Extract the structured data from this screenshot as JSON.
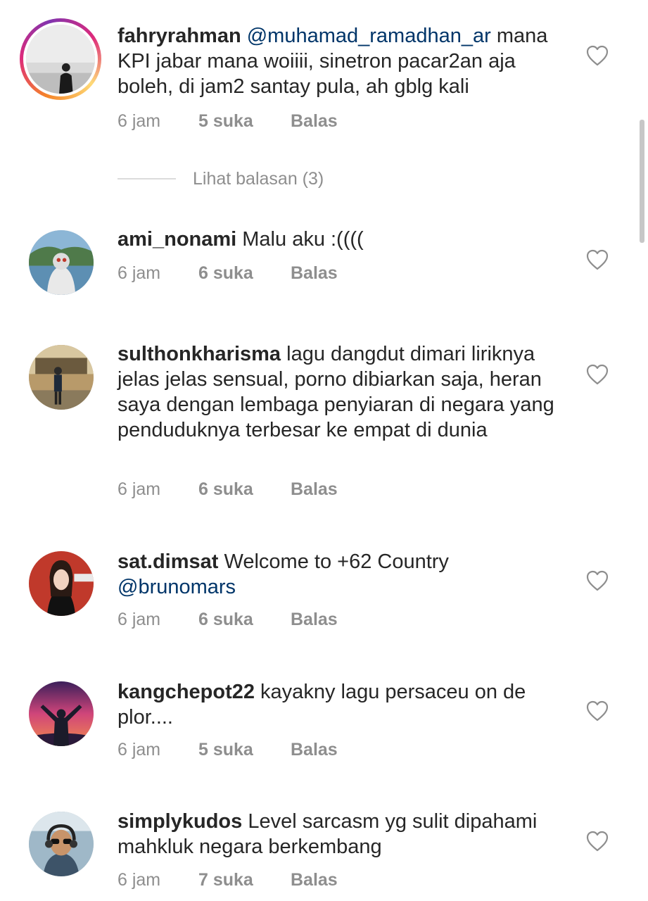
{
  "comments": [
    {
      "username": "fahryrahman",
      "mention": "@muhamad_ramadhan_ar",
      "text": " mana KPI jabar mana woiiii, sinetron pacar2an aja boleh, di jam2 santay pula, ah gblg kali",
      "time": "6 jam",
      "likes": "5 suka",
      "reply": "Balas",
      "avatar": "person-silhouette-grey-sky"
    },
    {
      "username": "ami_nonami",
      "text": " Malu aku :((((",
      "time": "6 jam",
      "likes": "6 suka",
      "reply": "Balas",
      "avatar": "person-beach-headscarf"
    },
    {
      "username": "sulthonkharisma",
      "text": " lagu dangdut dimari liriknya jelas jelas sensual, porno dibiarkan saja, heran saya dengan lembaga penyiaran di negara yang penduduknya terbesar ke empat di dunia",
      "time": "6 jam",
      "likes": "6 suka",
      "reply": "Balas",
      "avatar": "person-standing-building"
    },
    {
      "username": "sat.dimsat",
      "text": " Welcome to +62 Country ",
      "mention": "@brunomars",
      "time": "6 jam",
      "likes": "6 suka",
      "reply": "Balas",
      "avatar": "woman-red-background"
    },
    {
      "username": "kangchepot22",
      "text": " kayakny lagu persaceu on de plor....",
      "time": "6 jam",
      "likes": "5 suka",
      "reply": "Balas",
      "avatar": "person-sunset-silhouette"
    },
    {
      "username": "simplykudos",
      "text": " Level sarcasm yg sulit dipahami mahkluk negara berkembang",
      "time": "6 jam",
      "likes": "7 suka",
      "reply": "Balas",
      "avatar": "pilot-headset-sunglasses"
    }
  ],
  "view_replies": "Lihat balasan (3)",
  "icons": {
    "like": "heart-outline-icon"
  },
  "colors": {
    "mention": "#003569",
    "muted": "#8e8e8e",
    "text": "#262626"
  }
}
